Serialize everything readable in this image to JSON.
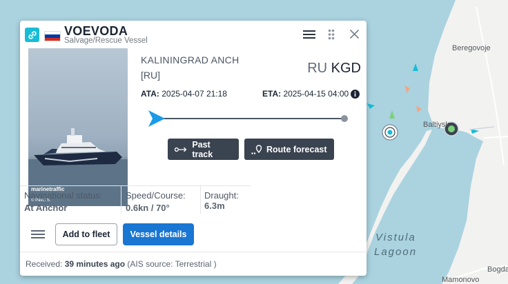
{
  "vessel": {
    "name": "VOEVODA",
    "type": "Salvage/Rescue Vessel",
    "flag_colors": [
      "#ffffff",
      "#0039a6",
      "#d52b1e"
    ]
  },
  "photo": {
    "watermark": "marinetraffic",
    "credit": "© Pavel S."
  },
  "voyage": {
    "port_name": "KALININGRAD ANCH",
    "port_country": "[RU]",
    "locode_country": "RU",
    "locode_port": "KGD",
    "ata_label": "ATA:",
    "ata_value": "2025-04-07 21:18",
    "eta_label": "ETA:",
    "eta_value": "2025-04-15 04:00",
    "progress": 0
  },
  "actions": {
    "past_track": "Past track",
    "route_forecast": "Route forecast",
    "add_to_fleet": "Add to fleet",
    "vessel_details": "Vessel details"
  },
  "status": {
    "nav_label": "Navigational status:",
    "nav_value": "At Anchor",
    "speed_label": "Speed/Course:",
    "speed_value": "0.6kn / 70°",
    "draught_label": "Draught:",
    "draught_value": "6.3m"
  },
  "footer": {
    "received_prefix": "Received:",
    "received_time": "39 minutes ago",
    "source": "(AIS source: Terrestrial )"
  },
  "map": {
    "labels": [
      "Beregovoje",
      "Baltiysk",
      "Vistula",
      "Lagoon",
      "Bogda",
      "Mamonovo"
    ]
  },
  "colors": {
    "accent": "#1976d2",
    "cyan": "#18bcd6",
    "track_arrow": "#1a9be8",
    "sea": "#aad3df",
    "land": "#f2f2f1"
  }
}
